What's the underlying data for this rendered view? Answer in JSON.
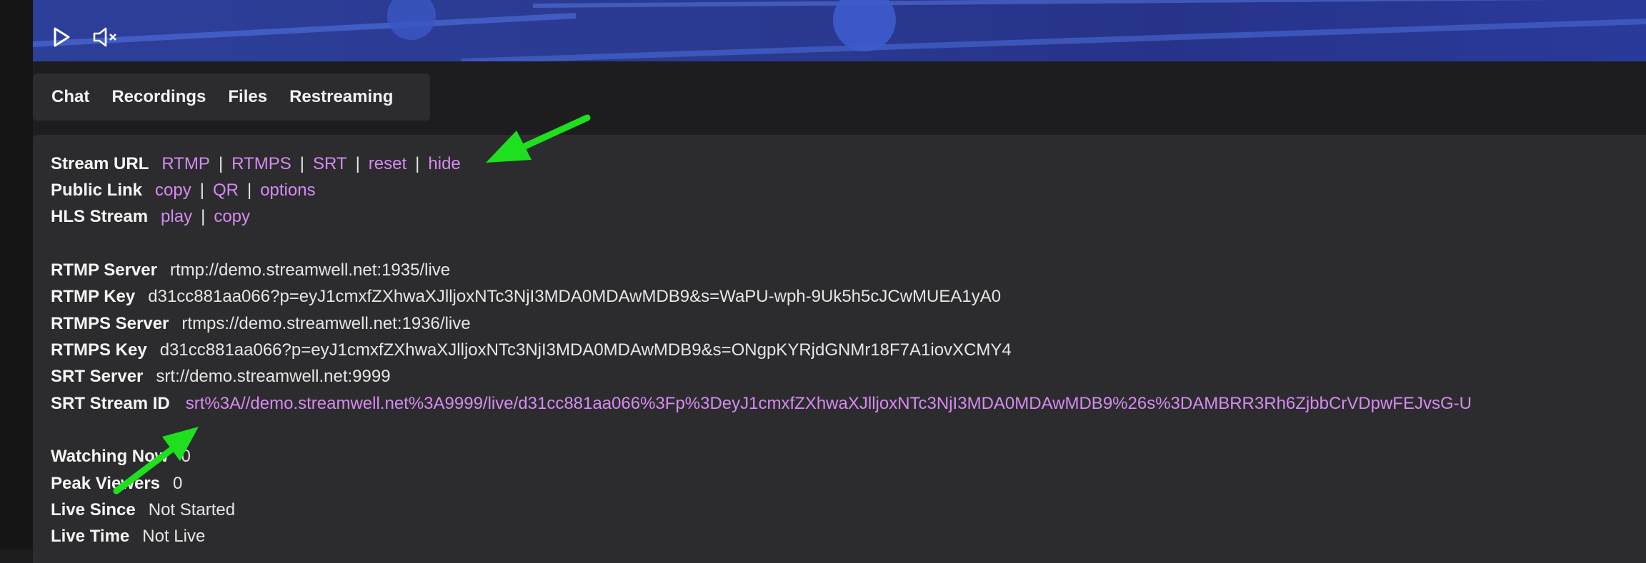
{
  "video": {
    "play_icon": "play-icon",
    "mute_icon": "speaker-muted-icon",
    "background": "#2b3a92"
  },
  "tabs": [
    "Chat",
    "Recordings",
    "Files",
    "Restreaming"
  ],
  "stream_url": {
    "label": "Stream URL",
    "links": [
      "RTMP",
      "RTMPS",
      "SRT",
      "reset",
      "hide"
    ]
  },
  "public_link": {
    "label": "Public Link",
    "links": [
      "copy",
      "QR",
      "options"
    ]
  },
  "hls_stream": {
    "label": "HLS Stream",
    "links": [
      "play",
      "copy"
    ]
  },
  "rtmp_server": {
    "label": "RTMP Server",
    "value": "rtmp://demo.streamwell.net:1935/live"
  },
  "rtmp_key": {
    "label": "RTMP Key",
    "value": "d31cc881aa066?p=eyJ1cmxfZXhwaXJlljoxNTc3NjI3MDA0MDAwMDB9&s=WaPU-wph-9Uk5h5cJCwMUEA1yA0"
  },
  "rtmps_server": {
    "label": "RTMPS Server",
    "value": "rtmps://demo.streamwell.net:1936/live"
  },
  "rtmps_key": {
    "label": "RTMPS Key",
    "value": "d31cc881aa066?p=eyJ1cmxfZXhwaXJlljoxNTc3NjI3MDA0MDAwMDB9&s=ONgpKYRjdGNMr18F7A1iovXCMY4"
  },
  "srt_server": {
    "label": "SRT Server",
    "value": "srt://demo.streamwell.net:9999"
  },
  "srt_stream_id": {
    "label": "SRT Stream ID",
    "value": "srt%3A//demo.streamwell.net%3A9999/live/d31cc881aa066%3Fp%3DeyJ1cmxfZXhwaXJlljoxNTc3NjI3MDA0MDAwMDB9%26s%3DAMBRR3Rh6ZjbbCrVDpwFEJvsG-U"
  },
  "watching_now": {
    "label": "Watching Now",
    "value": "0"
  },
  "peak_viewers": {
    "label": "Peak Viewers",
    "value": "0"
  },
  "live_since": {
    "label": "Live Since",
    "value": "Not Started"
  },
  "live_time": {
    "label": "Live Time",
    "value": "Not Live"
  },
  "colors": {
    "link": "#d78af2",
    "panel": "#2c2c2e",
    "page": "#1d1d1f",
    "arrow": "#1ee01e"
  },
  "annotations": {
    "arrow_icon": "green-arrow-icon"
  }
}
